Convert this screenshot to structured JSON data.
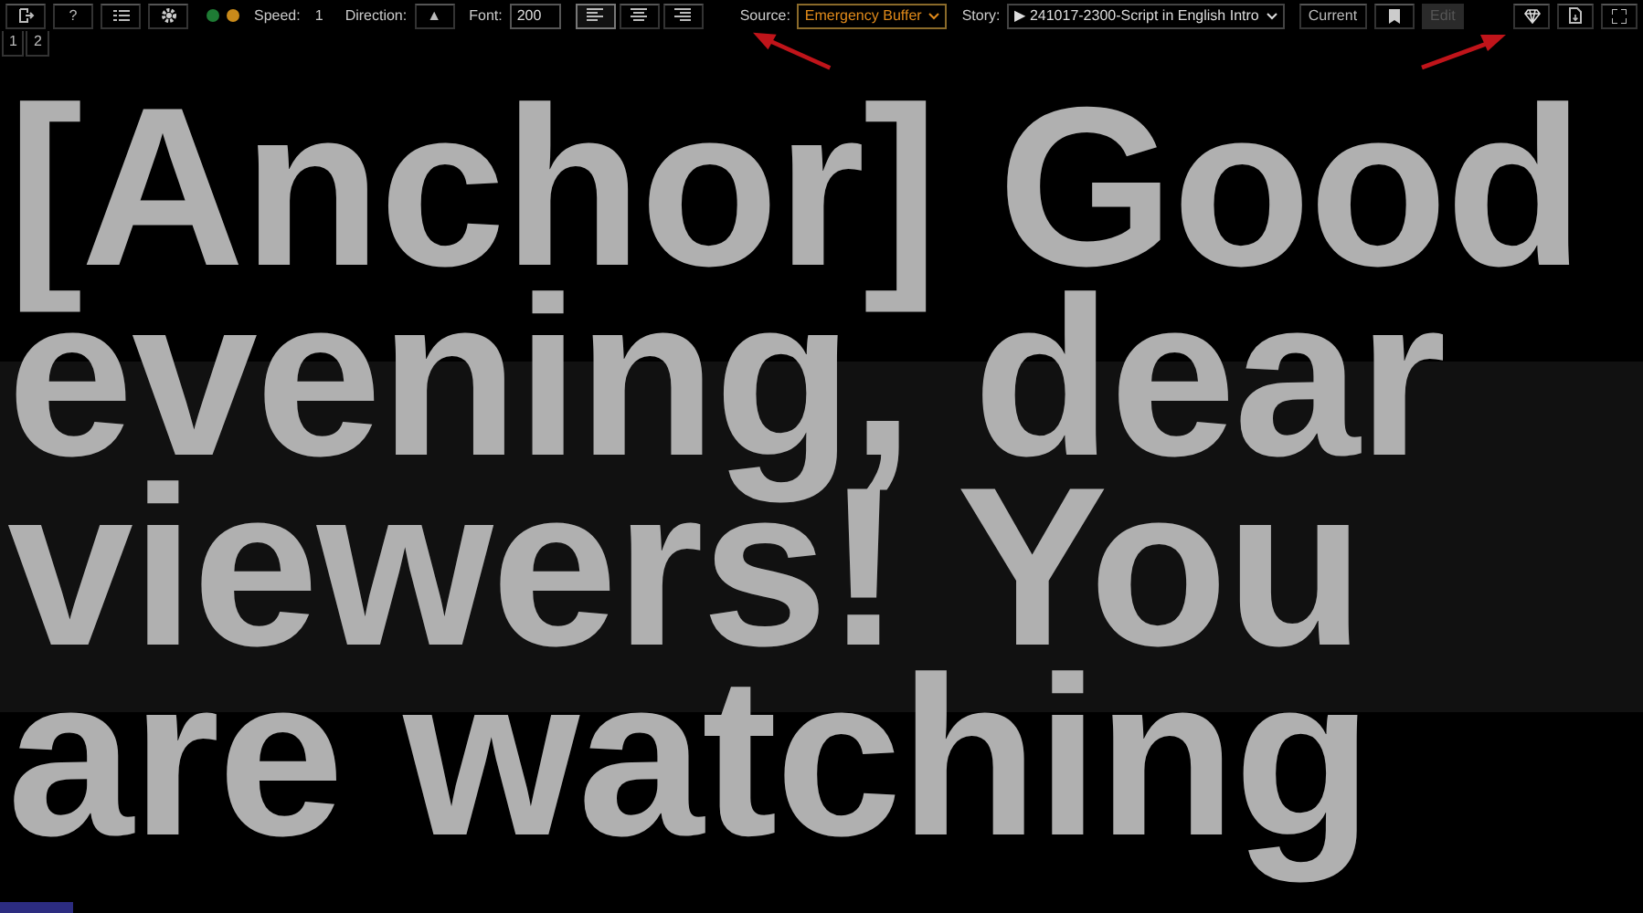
{
  "toolbar": {
    "left_buttons": [
      {
        "kind": "exit"
      },
      {
        "kind": "help",
        "label": "?"
      },
      {
        "kind": "list"
      },
      {
        "kind": "settings"
      }
    ],
    "status_dots": [
      {
        "color": "#1e7b34"
      },
      {
        "color": "#c98a1a"
      }
    ],
    "speed": {
      "label": "Speed:",
      "value": "1"
    },
    "direction": {
      "label": "Direction:",
      "button": "▲"
    },
    "font": {
      "label": "Font:",
      "value": "200"
    },
    "alignment": [
      {
        "kind": "left",
        "selected": true
      },
      {
        "kind": "center",
        "selected": false
      },
      {
        "kind": "right",
        "selected": false
      }
    ],
    "source": {
      "label": "Source:",
      "value": "Emergency Buffer"
    },
    "story": {
      "label": "Story:",
      "value": "▶ 241017-2300-Script in English Intro"
    },
    "current_button": "Current",
    "edit_button": {
      "label": "Edit",
      "disabled": true
    },
    "right_buttons": [
      {
        "kind": "diamond"
      },
      {
        "kind": "file"
      },
      {
        "kind": "fullscreen"
      }
    ]
  },
  "pages": [
    {
      "label": "1",
      "selected": false
    },
    {
      "label": "2",
      "selected": false
    }
  ],
  "prompter_text": "[Anchor] Good evening, dear viewers! You are watching"
}
